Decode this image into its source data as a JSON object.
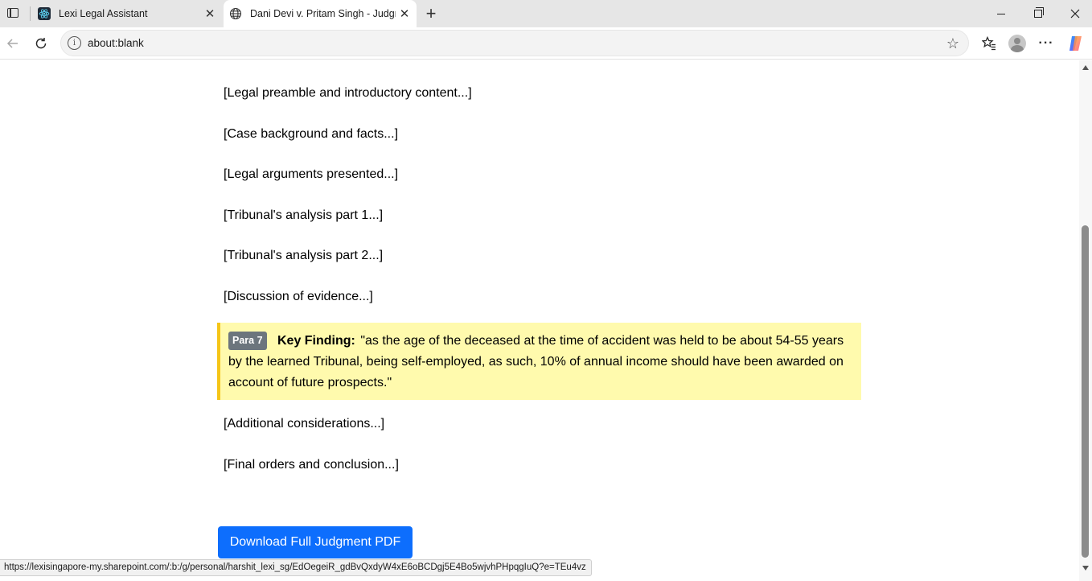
{
  "browser": {
    "tabs": [
      {
        "title": "Lexi Legal Assistant",
        "favicon": "react-icon",
        "active": false
      },
      {
        "title": "Dani Devi v. Pritam Singh - Judgm",
        "favicon": "globe-icon",
        "active": true
      }
    ],
    "address": "about:blank",
    "status_url": "https://lexisingapore-my.sharepoint.com/:b:/g/personal/harshit_lexi_sg/EdOegeiR_gdBvQxdyW4xE6oBCDgj5E4Bo5wjvhPHpqgIuQ?e=TEu4vz"
  },
  "document": {
    "paragraphs_before": [
      "[Legal preamble and introductory content...]",
      "[Case background and facts...]",
      "[Legal arguments presented...]",
      "[Tribunal's analysis part 1...]",
      "[Tribunal's analysis part 2...]",
      "[Discussion of evidence...]"
    ],
    "key_finding": {
      "badge": "Para 7",
      "label": "Key Finding:",
      "quote": "\"as the age of the deceased at the time of accident was held to be about 54-55 years by the learned Tribunal, being self-employed, as such, 10% of annual income should have been awarded on account of future prospects.\""
    },
    "paragraphs_after": [
      "[Additional considerations...]",
      "[Final orders and conclusion...]"
    ],
    "download_label": "Download Full Judgment PDF"
  },
  "colors": {
    "highlight_bg": "#fffaad",
    "highlight_border": "#f5c518",
    "badge_bg": "#6c757d",
    "button_bg": "#0d6efd"
  }
}
